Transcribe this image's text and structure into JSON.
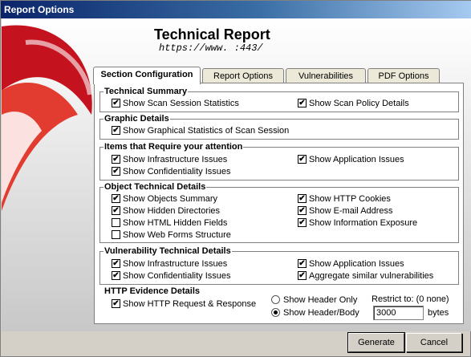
{
  "window": {
    "title": "Report Options"
  },
  "header": {
    "title": "Technical Report",
    "url": "https://www.                           :443/"
  },
  "tabs": [
    {
      "label": "Section Configuration",
      "active": true
    },
    {
      "label": "Report Options",
      "active": false
    },
    {
      "label": "Vulnerabilities",
      "active": false
    },
    {
      "label": "PDF Options",
      "active": false
    }
  ],
  "groups": {
    "technical_summary": {
      "title": "Technical Summary",
      "items": [
        {
          "label": "Show Scan Session Statistics",
          "checked": true
        },
        {
          "label": "Show Scan Policy Details",
          "checked": true
        }
      ]
    },
    "graphic_details": {
      "title": "Graphic Details",
      "items": [
        {
          "label": "Show Graphical Statistics of Scan Session",
          "checked": true
        }
      ]
    },
    "attention": {
      "title": "Items that Require your attention",
      "items": [
        {
          "label": "Show Infrastructure Issues",
          "checked": true
        },
        {
          "label": "Show Application Issues",
          "checked": true
        },
        {
          "label": "Show Confidentiality Issues",
          "checked": true
        }
      ]
    },
    "object_details": {
      "title": "Object Technical Details",
      "items": [
        {
          "label": "Show Objects Summary",
          "checked": true
        },
        {
          "label": "Show HTTP Cookies",
          "checked": true
        },
        {
          "label": "Show Hidden Directories",
          "checked": true
        },
        {
          "label": "Show E-mail Address",
          "checked": true
        },
        {
          "label": "Show HTML Hidden Fields",
          "checked": false
        },
        {
          "label": "Show Information Exposure",
          "checked": true
        },
        {
          "label": "Show Web Forms Structure",
          "checked": false
        }
      ]
    },
    "vuln_details": {
      "title": "Vulnerability Technical Details",
      "items": [
        {
          "label": "Show Infrastructure Issues",
          "checked": true
        },
        {
          "label": "Show Application Issues",
          "checked": true
        },
        {
          "label": "Show Confidentiality Issues",
          "checked": true
        },
        {
          "label": "Aggregate similar vulnerabilities",
          "checked": true
        }
      ]
    },
    "http_evidence": {
      "title": "HTTP Evidence Details",
      "request_response": {
        "label": "Show HTTP Request & Response",
        "checked": true
      },
      "header_only": {
        "label": "Show Header Only",
        "selected": false
      },
      "header_body": {
        "label": "Show Header/Body",
        "selected": true
      },
      "restrict_label": "Restrict to: (0 none)",
      "restrict_value": "3000",
      "restrict_unit": "bytes"
    }
  },
  "buttons": {
    "generate": "Generate",
    "cancel": "Cancel"
  },
  "colors": {
    "title_start": "#0a246a",
    "title_end": "#a6caf0",
    "logo_red": "#d81e2a"
  },
  "icons": {
    "logo": "red-swoosh-logo",
    "check": "checkmark-icon"
  }
}
